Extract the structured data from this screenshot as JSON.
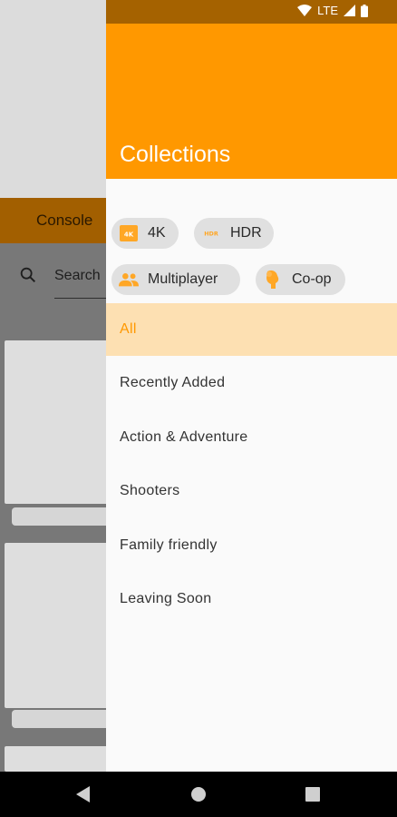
{
  "status_bar": {
    "network": "LTE",
    "icons": [
      "wifi-icon",
      "signal-icon",
      "battery-icon"
    ]
  },
  "background": {
    "tab_label": "Console",
    "search_placeholder": "Search"
  },
  "drawer": {
    "title": "Collections",
    "filters": [
      {
        "label": "4K",
        "icon": "4k-icon"
      },
      {
        "label": "HDR",
        "icon": "hdr-icon"
      },
      {
        "label": "Multiplayer",
        "icon": "people-icon"
      },
      {
        "label": "Co-op",
        "icon": "handshake-icon"
      }
    ],
    "items": [
      {
        "label": "All",
        "active": true
      },
      {
        "label": "Recently Added"
      },
      {
        "label": "Action & Adventure"
      },
      {
        "label": "Shooters"
      },
      {
        "label": "Family friendly"
      },
      {
        "label": "Leaving Soon"
      }
    ]
  },
  "colors": {
    "accent": "#ff9800",
    "header_dark": "#a56200",
    "active_bg": "#fde0b2"
  },
  "nav_bar": {
    "buttons": [
      "back-icon",
      "home-icon",
      "recents-icon"
    ]
  }
}
